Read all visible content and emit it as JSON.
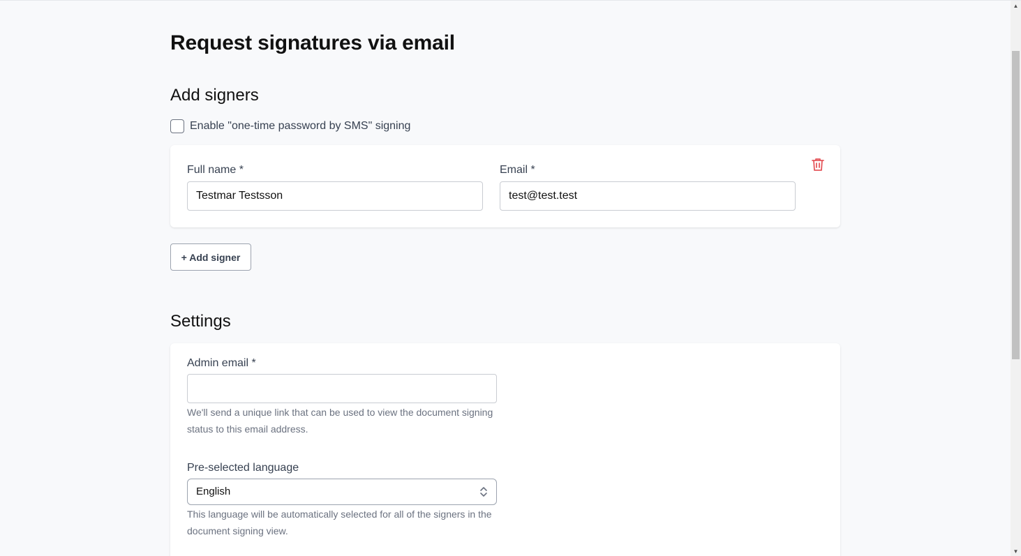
{
  "page": {
    "title": "Request signatures via email"
  },
  "signers_section": {
    "title": "Add signers",
    "sms_checkbox_label": "Enable \"one-time password by SMS\" signing",
    "sms_checked": false,
    "signers": [
      {
        "full_name_label": "Full name *",
        "full_name_value": "Testmar Testsson",
        "email_label": "Email *",
        "email_value": "test@test.test",
        "delete_icon": "trash-icon"
      }
    ],
    "add_signer_label": "+ Add signer"
  },
  "settings_section": {
    "title": "Settings",
    "admin_email_label": "Admin email *",
    "admin_email_value": "",
    "admin_email_help": "We'll send a unique link that can be used to view the document signing status to this email address.",
    "language_label": "Pre-selected language",
    "language_value": "English",
    "language_help": "This language will be automatically selected for all of the signers in the document signing view."
  },
  "colors": {
    "background": "#f8f9fb",
    "card": "#ffffff",
    "delete_icon": "#e5575c"
  }
}
